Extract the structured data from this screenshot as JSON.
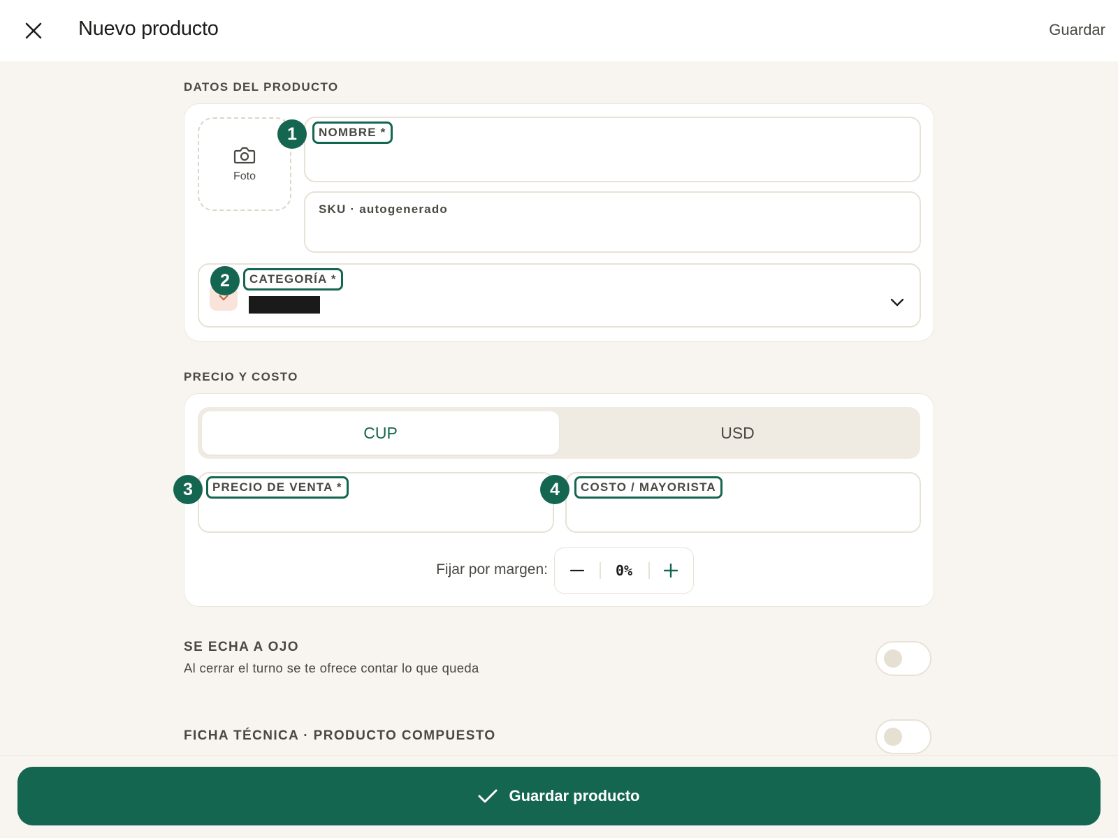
{
  "header": {
    "title": "Nuevo producto",
    "save_label": "Guardar"
  },
  "product_section": {
    "label": "DATOS DEL PRODUCTO",
    "photo_label": "Foto",
    "name": {
      "label": "NOMBRE *",
      "value": "",
      "badge": "1"
    },
    "sku": {
      "label": "SKU · autogenerado",
      "value": ""
    },
    "category": {
      "label": "CATEGORÍA *",
      "badge": "2",
      "value": ""
    }
  },
  "price_section": {
    "label": "PRECIO Y COSTO",
    "currencies": [
      "CUP",
      "USD"
    ],
    "selected_currency": "CUP",
    "sale_price": {
      "label": "PRECIO DE VENTA *",
      "value": "",
      "badge": "3"
    },
    "cost": {
      "label": "COSTO / MAYORISTA",
      "value": "",
      "badge": "4"
    },
    "margin": {
      "label": "Fijar por margen:",
      "value": "0%"
    }
  },
  "toggles": {
    "eyeball": {
      "title": "SE ECHA A OJO",
      "subtitle": "Al cerrar el turno se te ofrece contar lo que queda",
      "on": false
    },
    "composite": {
      "title": "FICHA TÉCNICA · PRODUCTO COMPUESTO",
      "on": false
    }
  },
  "footer": {
    "save_label": "Guardar producto"
  },
  "colors": {
    "accent": "#146650",
    "background": "#f8f5f0",
    "border": "#e8e2d6"
  },
  "icons": [
    "close-icon",
    "camera-icon",
    "chevron-down-icon",
    "minus-icon",
    "plus-icon",
    "check-icon"
  ]
}
